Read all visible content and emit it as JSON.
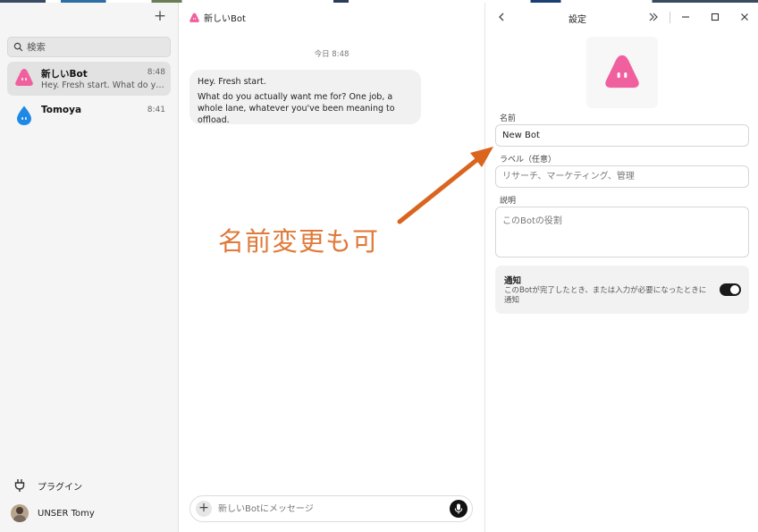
{
  "sidebar": {
    "search_placeholder": "検索",
    "chats": [
      {
        "name": "新しいBot",
        "time": "8:48",
        "preview": "Hey. Fresh start. What do you a…"
      },
      {
        "name": "Tomoya",
        "time": "8:41",
        "preview": ""
      }
    ],
    "plugins_label": "プラグイン",
    "user_name": "UNSER Tomy"
  },
  "chat": {
    "title": "新しいBot",
    "date_label": "今日 8:48",
    "message_line1": "Hey. Fresh start.",
    "message_line2": "What do you actually want me for? One job, a whole lane, whatever you've been meaning to offload.",
    "composer_placeholder": "新しいBotにメッセージ"
  },
  "settings": {
    "title": "設定",
    "name_label": "名前",
    "name_value": "New Bot",
    "tag_label": "ラベル（任意）",
    "tag_placeholder": "リサーチ、マーケティング、管理",
    "desc_label": "説明",
    "desc_placeholder": "このBotの役割",
    "notify_title": "通知",
    "notify_desc": "このBotが完了したとき、または入力が必要になったときに通知",
    "notify_on": true
  },
  "annotation": {
    "text": "名前変更も可",
    "color": "#e07a3a"
  },
  "colors": {
    "bot_pink": "#f0609e",
    "drop_blue": "#1e88e5",
    "toggle_on": "#1a1a1a"
  }
}
